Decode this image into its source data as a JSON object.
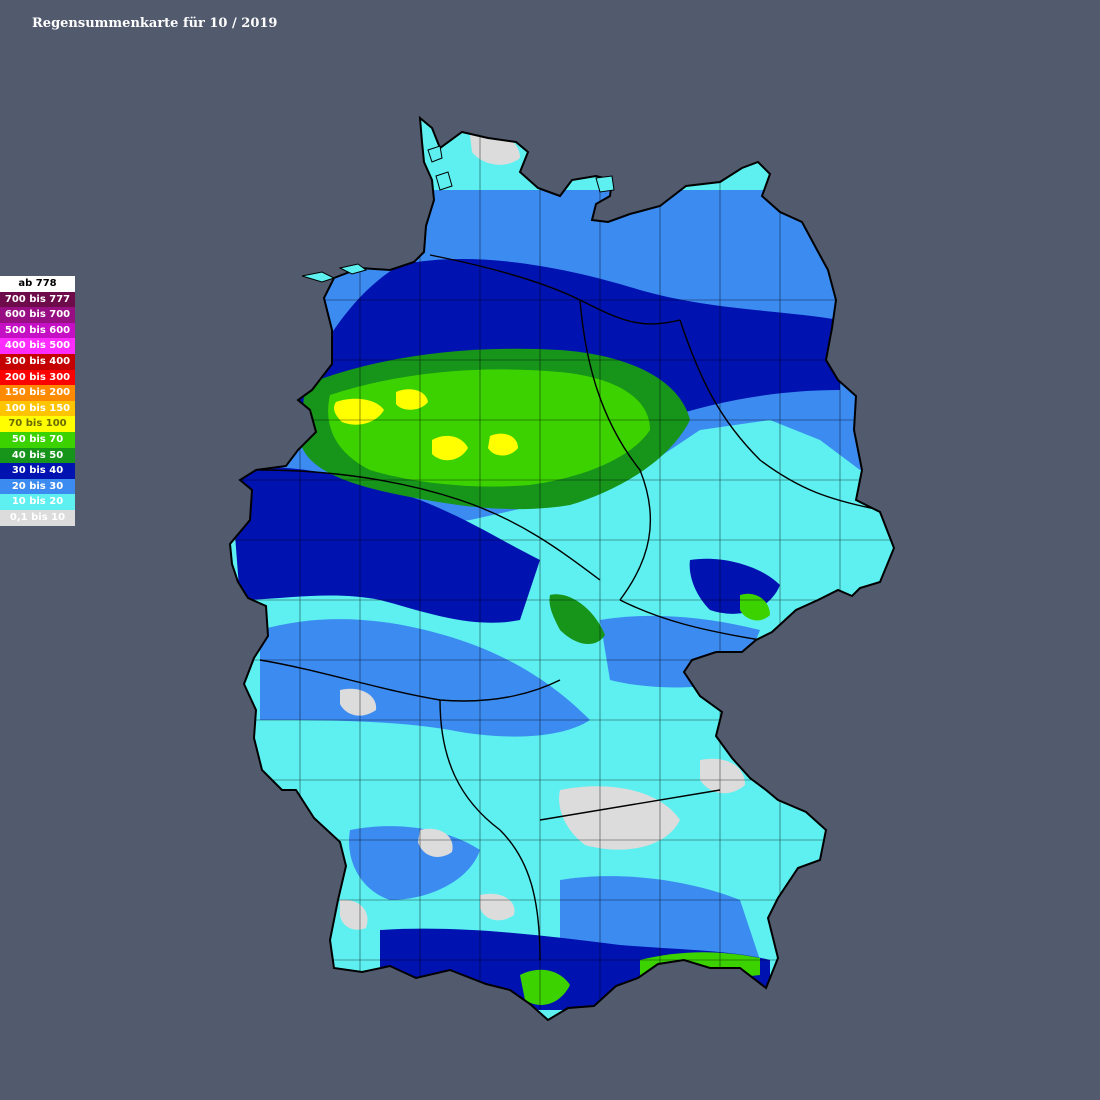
{
  "title": "Regensummenkarte für 10 / 2019",
  "legend": {
    "items": [
      {
        "label": "ab 778",
        "color": "#ffffff",
        "text_color": "#000000"
      },
      {
        "label": "700 bis 777",
        "color": "#6e0b4a",
        "text_color": "#ffffff"
      },
      {
        "label": "600 bis 700",
        "color": "#970f82",
        "text_color": "#ffffff"
      },
      {
        "label": "500 bis 600",
        "color": "#c40fc4",
        "text_color": "#ffffff"
      },
      {
        "label": "400 bis 500",
        "color": "#ff2cff",
        "text_color": "#ffffff"
      },
      {
        "label": "300 bis 400",
        "color": "#c40000",
        "text_color": "#ffffff"
      },
      {
        "label": "200 bis 300",
        "color": "#ff0000",
        "text_color": "#ffffff"
      },
      {
        "label": "150 bis 200",
        "color": "#ff8a00",
        "text_color": "#ffffff"
      },
      {
        "label": "100 bis 150",
        "color": "#ffc400",
        "text_color": "#ffffff"
      },
      {
        "label": "70 bis 100",
        "color": "#ffff00",
        "text_color": "#6a6a00"
      },
      {
        "label": "50 bis 70",
        "color": "#3cd200",
        "text_color": "#ffffff"
      },
      {
        "label": "40 bis 50",
        "color": "#17941a",
        "text_color": "#ffffff"
      },
      {
        "label": "30 bis 40",
        "color": "#0012b0",
        "text_color": "#ffffff"
      },
      {
        "label": "20 bis 30",
        "color": "#3c8bf0",
        "text_color": "#ffffff"
      },
      {
        "label": "10 bis 20",
        "color": "#5ef0f0",
        "text_color": "#ffffff"
      },
      {
        "label": "0,1 bis 10",
        "color": "#dcdcdc",
        "text_color": "#ffffff"
      }
    ]
  }
}
